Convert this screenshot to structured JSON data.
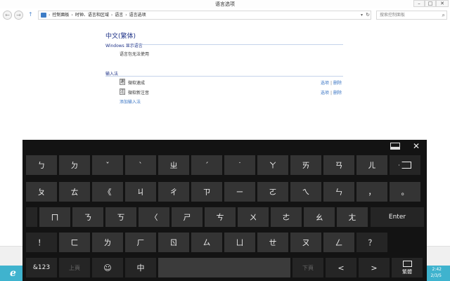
{
  "window": {
    "title": "语言选项",
    "min_glyph": "–",
    "max_glyph": "□",
    "close_glyph": "✕"
  },
  "address_bar": {
    "back_glyph": "←",
    "forward_glyph": "→",
    "up_glyph": "↑",
    "crumbs": [
      "控制面板",
      "时钟、语言和区域",
      "语言",
      "语言选项"
    ],
    "crumb_separator": "›",
    "dropdown_glyph": "▾",
    "refresh_glyph": "↻",
    "search_placeholder": "搜索控制面板",
    "search_glyph": "⌕"
  },
  "content": {
    "language_title": "中文(繁体)",
    "display_section_label": "Windows 显示语言",
    "display_status": "语言包无法使用",
    "ime_section_label": "输入法",
    "ime_list": [
      {
        "icon": "速",
        "name": "微软速成",
        "options": "选项",
        "sep": "|",
        "remove": "删除"
      },
      {
        "icon": "注",
        "name": "微软新注音",
        "options": "选项",
        "sep": "|",
        "remove": "删除"
      }
    ],
    "add_ime": "添加输入法"
  },
  "taskbar": {
    "ie_glyph": "e",
    "time": "2:42",
    "date": "2/3/5"
  },
  "keyboard": {
    "close_glyph": "✕",
    "rows": [
      [
        "ㄅ",
        "ㄉ",
        "ˇ",
        "ˋ",
        "ㄓ",
        "ˊ",
        "˙",
        "ㄚ",
        "ㄞ",
        "ㄢ",
        "ㄦ",
        "backspace"
      ],
      [
        "ㄆ",
        "ㄊ",
        "《",
        "ㄐ",
        "ㄔ",
        "ㄗ",
        "ㄧ",
        "ㄛ",
        "ㄟ",
        "ㄣ",
        "，",
        "。"
      ],
      [
        "ㄇ",
        "ㄋ",
        "ㄎ",
        "〈",
        "ㄕ",
        "ㄘ",
        "ㄨ",
        "ㄜ",
        "ㄠ",
        "ㄤ",
        "Enter"
      ],
      [
        "！",
        "ㄈ",
        "ㄌ",
        "ㄏ",
        "ㄖ",
        "ㄙ",
        "ㄩ",
        "ㄝ",
        "ㄡ",
        "ㄥ",
        "？"
      ],
      [
        "&123",
        "上頁",
        "☺",
        "中",
        "",
        "下頁",
        "<",
        ">",
        "繁體"
      ]
    ]
  }
}
